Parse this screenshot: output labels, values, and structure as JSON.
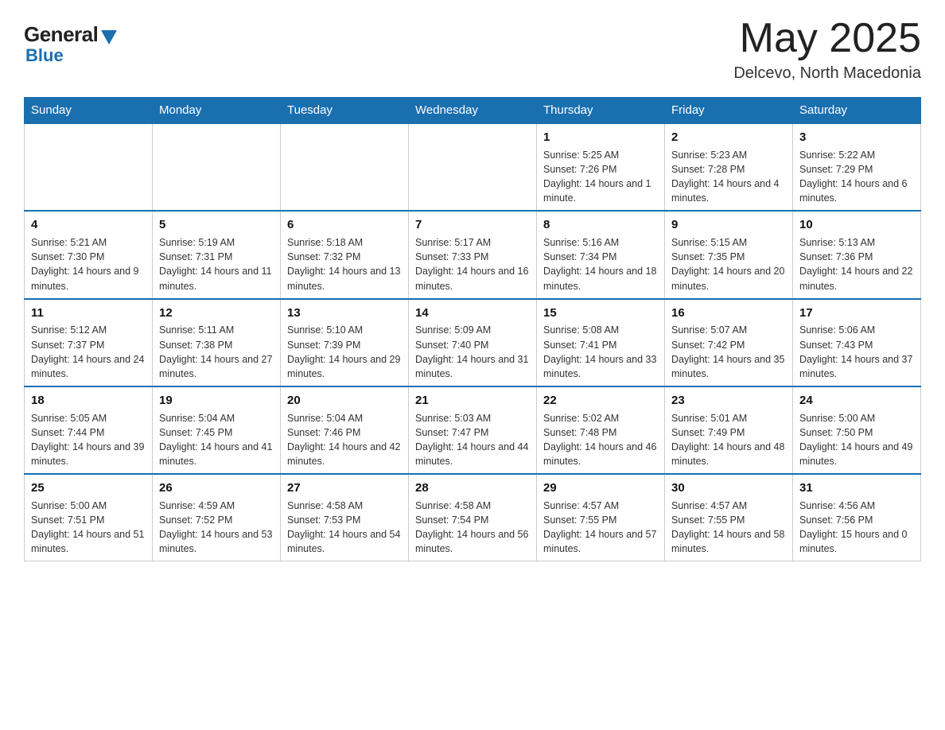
{
  "header": {
    "logo": {
      "general": "General",
      "blue": "Blue"
    },
    "title": "May 2025",
    "location": "Delcevo, North Macedonia"
  },
  "days_of_week": [
    "Sunday",
    "Monday",
    "Tuesday",
    "Wednesday",
    "Thursday",
    "Friday",
    "Saturday"
  ],
  "weeks": [
    {
      "days": [
        {
          "num": "",
          "info": ""
        },
        {
          "num": "",
          "info": ""
        },
        {
          "num": "",
          "info": ""
        },
        {
          "num": "",
          "info": ""
        },
        {
          "num": "1",
          "info": "Sunrise: 5:25 AM\nSunset: 7:26 PM\nDaylight: 14 hours and 1 minute."
        },
        {
          "num": "2",
          "info": "Sunrise: 5:23 AM\nSunset: 7:28 PM\nDaylight: 14 hours and 4 minutes."
        },
        {
          "num": "3",
          "info": "Sunrise: 5:22 AM\nSunset: 7:29 PM\nDaylight: 14 hours and 6 minutes."
        }
      ]
    },
    {
      "days": [
        {
          "num": "4",
          "info": "Sunrise: 5:21 AM\nSunset: 7:30 PM\nDaylight: 14 hours and 9 minutes."
        },
        {
          "num": "5",
          "info": "Sunrise: 5:19 AM\nSunset: 7:31 PM\nDaylight: 14 hours and 11 minutes."
        },
        {
          "num": "6",
          "info": "Sunrise: 5:18 AM\nSunset: 7:32 PM\nDaylight: 14 hours and 13 minutes."
        },
        {
          "num": "7",
          "info": "Sunrise: 5:17 AM\nSunset: 7:33 PM\nDaylight: 14 hours and 16 minutes."
        },
        {
          "num": "8",
          "info": "Sunrise: 5:16 AM\nSunset: 7:34 PM\nDaylight: 14 hours and 18 minutes."
        },
        {
          "num": "9",
          "info": "Sunrise: 5:15 AM\nSunset: 7:35 PM\nDaylight: 14 hours and 20 minutes."
        },
        {
          "num": "10",
          "info": "Sunrise: 5:13 AM\nSunset: 7:36 PM\nDaylight: 14 hours and 22 minutes."
        }
      ]
    },
    {
      "days": [
        {
          "num": "11",
          "info": "Sunrise: 5:12 AM\nSunset: 7:37 PM\nDaylight: 14 hours and 24 minutes."
        },
        {
          "num": "12",
          "info": "Sunrise: 5:11 AM\nSunset: 7:38 PM\nDaylight: 14 hours and 27 minutes."
        },
        {
          "num": "13",
          "info": "Sunrise: 5:10 AM\nSunset: 7:39 PM\nDaylight: 14 hours and 29 minutes."
        },
        {
          "num": "14",
          "info": "Sunrise: 5:09 AM\nSunset: 7:40 PM\nDaylight: 14 hours and 31 minutes."
        },
        {
          "num": "15",
          "info": "Sunrise: 5:08 AM\nSunset: 7:41 PM\nDaylight: 14 hours and 33 minutes."
        },
        {
          "num": "16",
          "info": "Sunrise: 5:07 AM\nSunset: 7:42 PM\nDaylight: 14 hours and 35 minutes."
        },
        {
          "num": "17",
          "info": "Sunrise: 5:06 AM\nSunset: 7:43 PM\nDaylight: 14 hours and 37 minutes."
        }
      ]
    },
    {
      "days": [
        {
          "num": "18",
          "info": "Sunrise: 5:05 AM\nSunset: 7:44 PM\nDaylight: 14 hours and 39 minutes."
        },
        {
          "num": "19",
          "info": "Sunrise: 5:04 AM\nSunset: 7:45 PM\nDaylight: 14 hours and 41 minutes."
        },
        {
          "num": "20",
          "info": "Sunrise: 5:04 AM\nSunset: 7:46 PM\nDaylight: 14 hours and 42 minutes."
        },
        {
          "num": "21",
          "info": "Sunrise: 5:03 AM\nSunset: 7:47 PM\nDaylight: 14 hours and 44 minutes."
        },
        {
          "num": "22",
          "info": "Sunrise: 5:02 AM\nSunset: 7:48 PM\nDaylight: 14 hours and 46 minutes."
        },
        {
          "num": "23",
          "info": "Sunrise: 5:01 AM\nSunset: 7:49 PM\nDaylight: 14 hours and 48 minutes."
        },
        {
          "num": "24",
          "info": "Sunrise: 5:00 AM\nSunset: 7:50 PM\nDaylight: 14 hours and 49 minutes."
        }
      ]
    },
    {
      "days": [
        {
          "num": "25",
          "info": "Sunrise: 5:00 AM\nSunset: 7:51 PM\nDaylight: 14 hours and 51 minutes."
        },
        {
          "num": "26",
          "info": "Sunrise: 4:59 AM\nSunset: 7:52 PM\nDaylight: 14 hours and 53 minutes."
        },
        {
          "num": "27",
          "info": "Sunrise: 4:58 AM\nSunset: 7:53 PM\nDaylight: 14 hours and 54 minutes."
        },
        {
          "num": "28",
          "info": "Sunrise: 4:58 AM\nSunset: 7:54 PM\nDaylight: 14 hours and 56 minutes."
        },
        {
          "num": "29",
          "info": "Sunrise: 4:57 AM\nSunset: 7:55 PM\nDaylight: 14 hours and 57 minutes."
        },
        {
          "num": "30",
          "info": "Sunrise: 4:57 AM\nSunset: 7:55 PM\nDaylight: 14 hours and 58 minutes."
        },
        {
          "num": "31",
          "info": "Sunrise: 4:56 AM\nSunset: 7:56 PM\nDaylight: 15 hours and 0 minutes."
        }
      ]
    }
  ]
}
